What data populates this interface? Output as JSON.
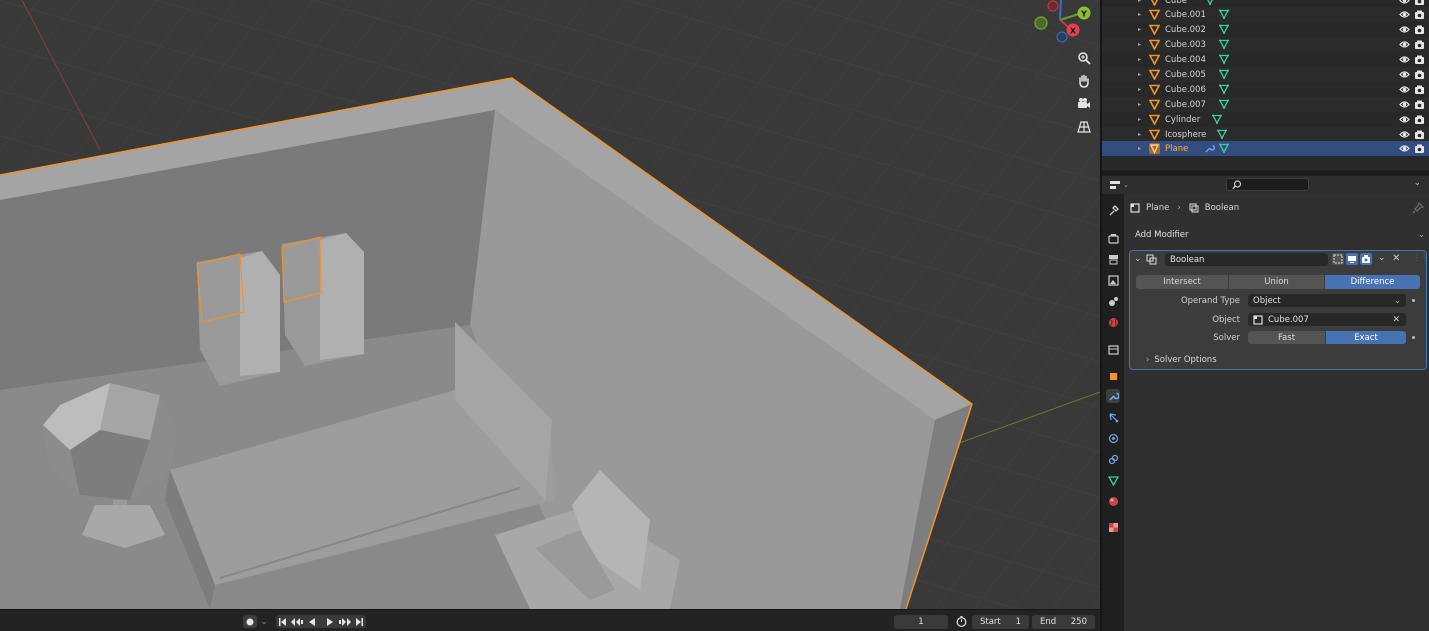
{
  "viewport": {
    "gizmo": {
      "x_label": "X",
      "y_label": "Y"
    },
    "tools": [
      "zoom-icon",
      "hand-pan-icon",
      "camera-icon",
      "grid-perspective-icon"
    ],
    "colors": {
      "selection_outline": "#f0932b",
      "background": "#393939"
    }
  },
  "timeline": {
    "current_frame": "1",
    "start_label": "Start",
    "start_value": "1",
    "end_label": "End",
    "end_value": "250"
  },
  "outliner": {
    "items": [
      {
        "name": "Cube"
      },
      {
        "name": "Cube.001"
      },
      {
        "name": "Cube.002"
      },
      {
        "name": "Cube.003"
      },
      {
        "name": "Cube.004"
      },
      {
        "name": "Cube.005"
      },
      {
        "name": "Cube.006"
      },
      {
        "name": "Cube.007"
      },
      {
        "name": "Cylinder"
      },
      {
        "name": "Icosphere"
      },
      {
        "name": "Plane"
      }
    ]
  },
  "properties": {
    "breadcrumb": {
      "object": "Plane",
      "modifier": "Boolean"
    },
    "add_modifier_label": "Add Modifier",
    "modifier": {
      "name": "Boolean",
      "operations": [
        "Intersect",
        "Union",
        "Difference"
      ],
      "active_operation": "Difference",
      "operand_type_label": "Operand Type",
      "operand_type_value": "Object",
      "object_label": "Object",
      "object_value": "Cube.007",
      "solver_label": "Solver",
      "solver_options": [
        "Fast",
        "Exact"
      ],
      "active_solver": "Exact",
      "solver_options_label": "Solver Options"
    }
  }
}
